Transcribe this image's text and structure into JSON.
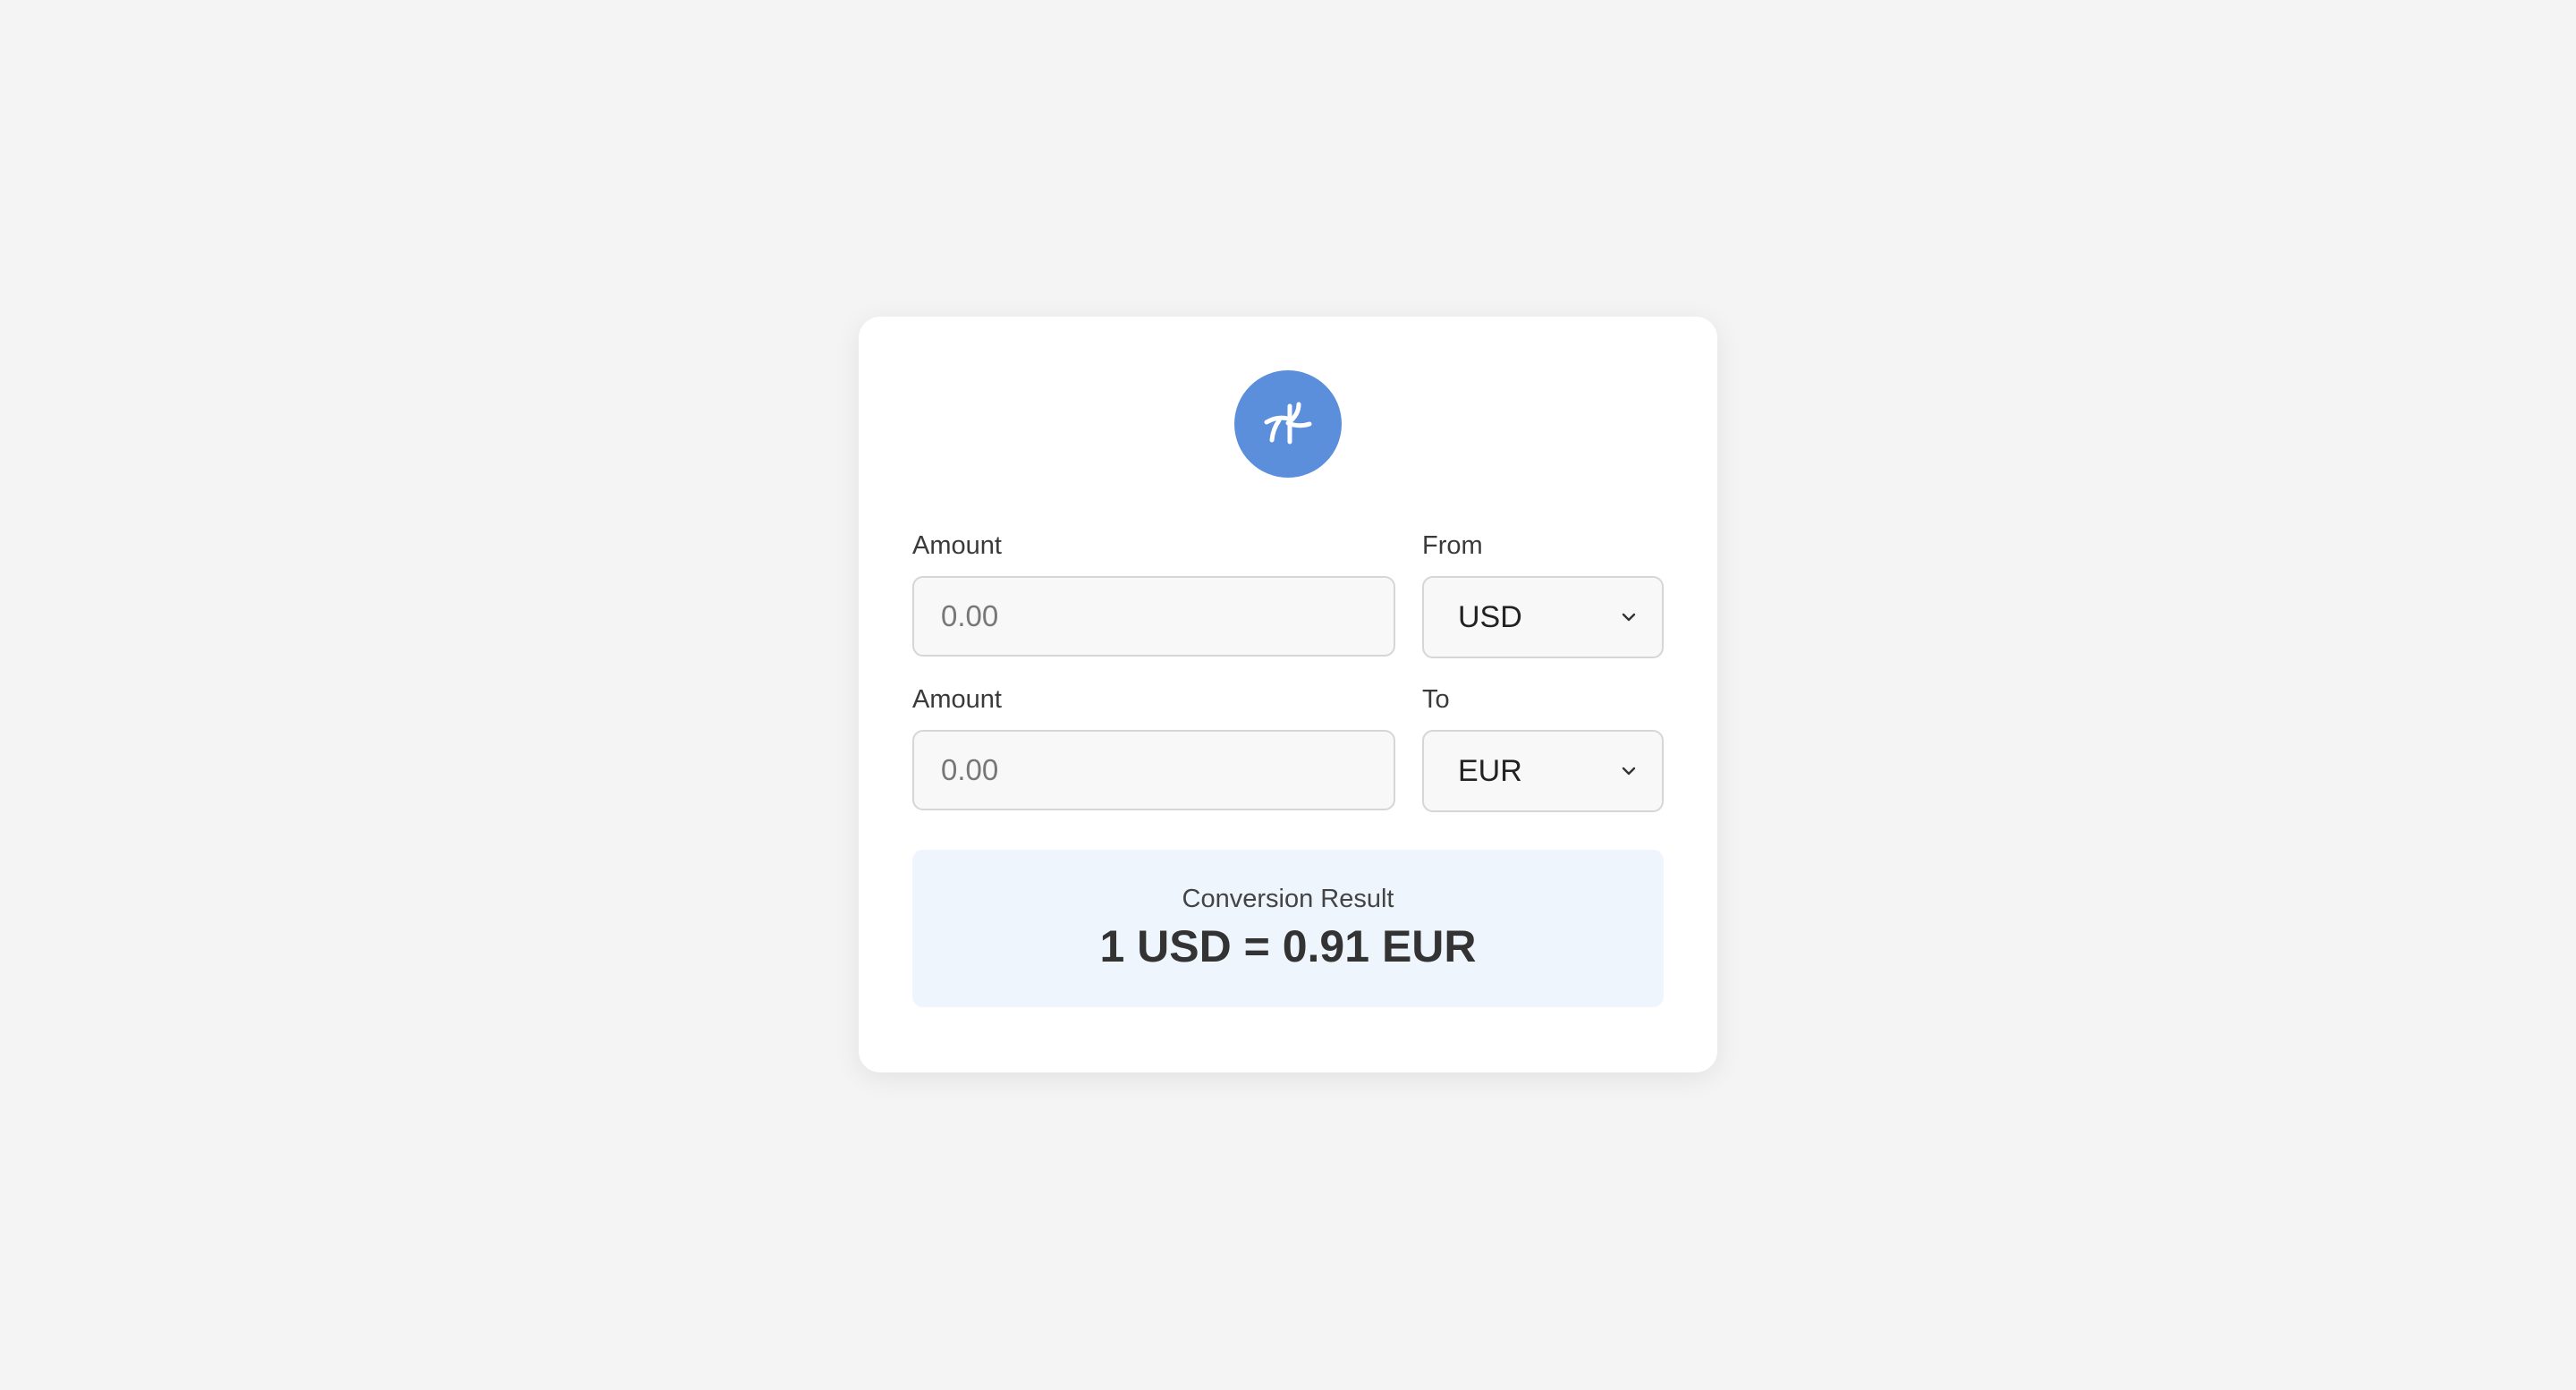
{
  "app": {
    "logo_icon": "currency-exchange-icon",
    "accent_color": "#5b8fdb",
    "background_color": "#f4f4f4",
    "result_background_color": "#eef5fd"
  },
  "from": {
    "amount_label": "Amount",
    "amount_placeholder": "0.00",
    "currency_label": "From",
    "currency_value": "USD"
  },
  "to": {
    "amount_label": "Amount",
    "amount_placeholder": "0.00",
    "currency_label": "To",
    "currency_value": "EUR"
  },
  "result": {
    "label": "Conversion Result",
    "value": "1 USD = 0.91 EUR"
  }
}
